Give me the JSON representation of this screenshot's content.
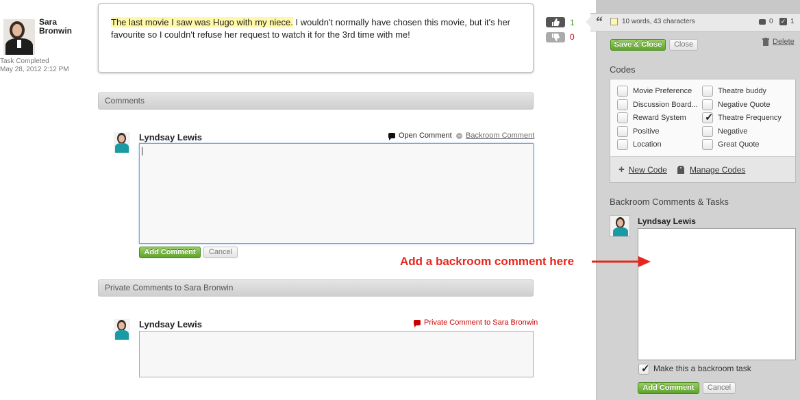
{
  "post": {
    "author_first": "Sara",
    "author_last": "Bronwin",
    "status": "Task Completed",
    "timestamp": "May 28, 2012 2:12 PM",
    "highlighted_text": "The last movie I saw was Hugo with my niece.",
    "rest_text": " I wouldn't normally have chosen this movie, but it's her favourite so I couldn't refuse her request to watch it for the 3rd time with me!",
    "likes": "1",
    "dislikes": "0"
  },
  "comments": {
    "section_title": "Comments",
    "commenter": "Lyndsay Lewis",
    "open_comment_label": "Open Comment",
    "backroom_comment_label": "Backroom Comment",
    "add_label": "Add Comment",
    "cancel_label": "Cancel"
  },
  "private_comments": {
    "section_title": "Private Comments to Sara Bronwin",
    "commenter": "Lyndsay Lewis",
    "private_label": "Private Comment to Sara Bronwin"
  },
  "annotation": "Add a backroom comment here",
  "panel": {
    "selection_info": "10 words, 43 characters",
    "comment_count": "0",
    "task_count": "1",
    "save_close_label": "Save & Close",
    "close_label": "Close",
    "delete_label": "Delete",
    "codes_title": "Codes",
    "codes_left": [
      {
        "label": "Movie Preference",
        "checked": false
      },
      {
        "label": "Discussion Board...",
        "checked": false
      },
      {
        "label": "Reward System",
        "checked": false
      },
      {
        "label": "Positive",
        "checked": false
      },
      {
        "label": "Location",
        "checked": false
      }
    ],
    "codes_right": [
      {
        "label": "Theatre buddy",
        "checked": false
      },
      {
        "label": "Negative Quote",
        "checked": false
      },
      {
        "label": "Theatre Frequency",
        "checked": true
      },
      {
        "label": "Negative",
        "checked": false
      },
      {
        "label": "Great Quote",
        "checked": false
      }
    ],
    "new_code_label": "New Code",
    "manage_codes_label": "Manage Codes",
    "backroom_title": "Backroom Comments & Tasks",
    "backroom_commenter": "Lyndsay Lewis",
    "backroom_task_label": "Make this a backroom task",
    "backroom_task_checked": true,
    "add_label": "Add Comment",
    "cancel_label": "Cancel"
  },
  "colors": {
    "accent_green": "#5fa22c",
    "like_green": "#3a9a1e",
    "dislike_red": "#cc0000",
    "annotation_red": "#e8261c",
    "highlight": "#fff8a8"
  }
}
